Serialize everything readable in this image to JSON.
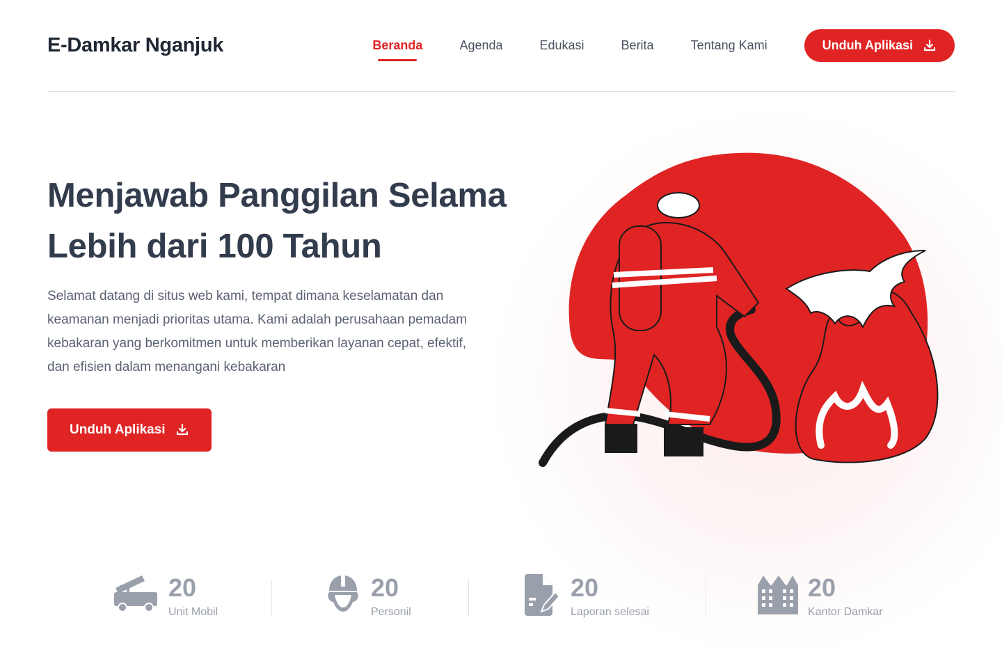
{
  "brand": "E-Damkar Nganjuk",
  "nav": [
    {
      "label": "Beranda",
      "active": true
    },
    {
      "label": "Agenda"
    },
    {
      "label": "Edukasi"
    },
    {
      "label": "Berita"
    },
    {
      "label": "Tentang Kami"
    }
  ],
  "cta_label": "Unduh Aplikasi",
  "hero": {
    "title_line1": "Menjawab Panggilan Selama",
    "title_line2": "Lebih dari 100 Tahun",
    "description": "Selamat datang di situs web kami, tempat dimana keselamatan dan keamanan menjadi prioritas utama. Kami adalah perusahaan pemadam kebakaran yang berkomitmen untuk memberikan layanan cepat, efektif, dan efisien dalam menangani kebakaran",
    "button_label": "Unduh Aplikasi"
  },
  "stats": [
    {
      "icon": "fire-truck-icon",
      "value": "20",
      "label": "Unit Mobil"
    },
    {
      "icon": "firefighter-helmet-icon",
      "value": "20",
      "label": "Personil"
    },
    {
      "icon": "report-icon",
      "value": "20",
      "label": "Laporan selesai"
    },
    {
      "icon": "building-icon",
      "value": "20",
      "label": "Kantor Damkar"
    }
  ],
  "colors": {
    "accent": "#e02424",
    "muted": "#9aa0ab"
  }
}
